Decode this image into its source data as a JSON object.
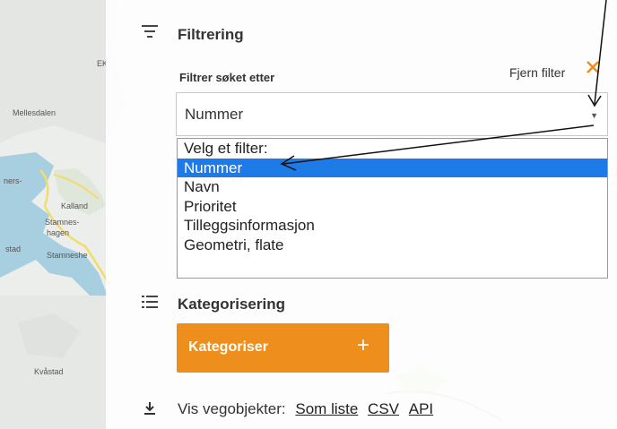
{
  "map": {
    "labels": [
      "EK",
      "Mellesdalen",
      "ners-",
      "Kalland",
      "Stamnes-",
      "hagen",
      "stad",
      "Stamneshe",
      "Kvåstad"
    ]
  },
  "filter": {
    "title": "Filtrering",
    "label": "Filtrer søket etter",
    "remove_label": "Fjern filter",
    "selected_value": "Nummer",
    "options": [
      "Velg et filter:",
      "Nummer",
      "Navn",
      "Prioritet",
      "Tilleggsinformasjon",
      "Geometri, flate"
    ],
    "selected_index": 1
  },
  "category": {
    "title": "Kategorisering",
    "button_label": "Kategoriser",
    "button_plus": "+"
  },
  "export": {
    "label": "Vis vegobjekter:",
    "links": [
      "Som liste",
      "CSV",
      "API"
    ]
  },
  "colors": {
    "accent": "#ee8f1d",
    "highlight": "#1e7ae6",
    "water": "#a8cfe0",
    "road": "#f2dc6a"
  }
}
